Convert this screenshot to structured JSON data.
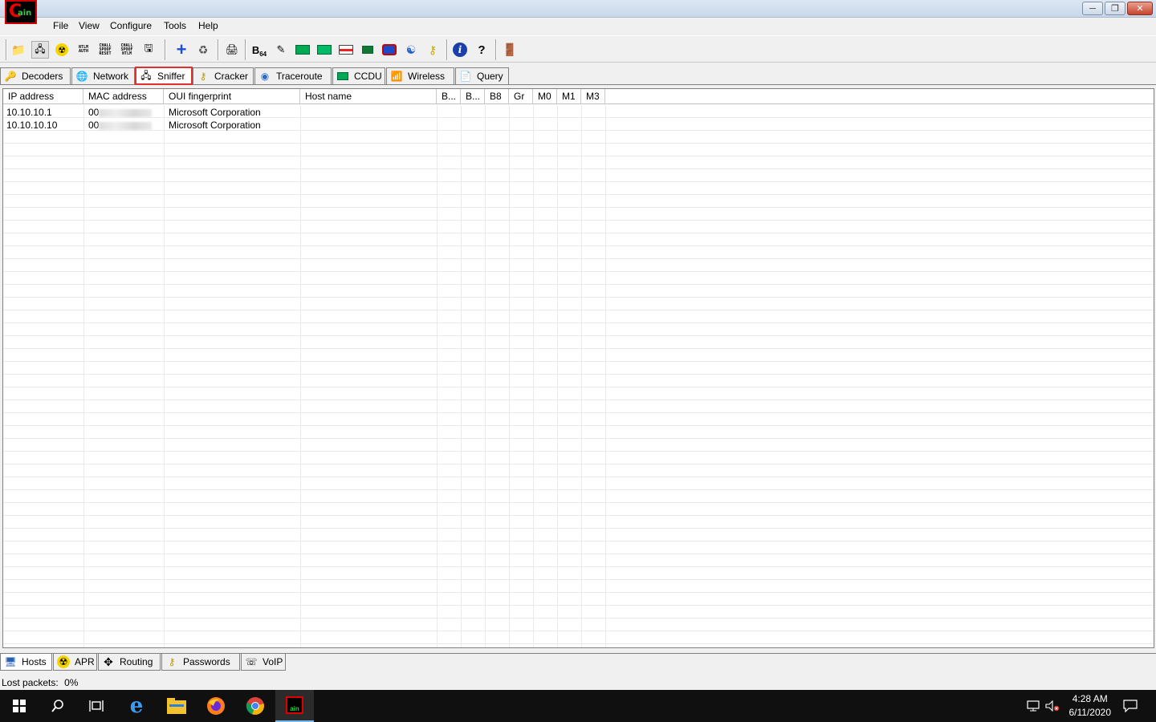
{
  "app": {
    "logo": "Cain",
    "window_buttons": [
      "minimize",
      "restore",
      "close"
    ]
  },
  "menu": [
    "File",
    "View",
    "Configure",
    "Tools",
    "Help"
  ],
  "toolbar_icons": {
    "ntlm_auth": [
      "NTLM",
      "AUTH"
    ],
    "chall_spoof_reset": [
      "CHALL",
      "SPOOF",
      "RESET"
    ],
    "chall_spoof_ntlm": [
      "CHALL",
      "SPOOF",
      "NTLM"
    ],
    "b64": "B",
    "b64_sub": "64"
  },
  "top_tabs": [
    "Decoders",
    "Network",
    "Sniffer",
    "Cracker",
    "Traceroute",
    "CCDU",
    "Wireless",
    "Query"
  ],
  "table": {
    "columns": [
      "IP address",
      "MAC address",
      "OUI fingerprint",
      "Host name",
      "B...",
      "B...",
      "B8",
      "Gr",
      "M0",
      "M1",
      "M3"
    ],
    "rows": [
      {
        "ip": "10.10.10.1",
        "mac_prefix": "00",
        "oui": "Microsoft Corporation"
      },
      {
        "ip": "10.10.10.10",
        "mac_prefix": "00",
        "oui": "Microsoft Corporation"
      }
    ]
  },
  "bottom_tabs": [
    "Hosts",
    "APR",
    "Routing",
    "Passwords",
    "VoIP"
  ],
  "status": {
    "lost_packets_label": "Lost packets:",
    "lost_packets_value": "0%"
  },
  "taskbar": {
    "time": "4:28 AM",
    "date": "6/11/2020"
  },
  "colors": {
    "active_tab_outline": "#e03030",
    "taskbar_bg": "#101010",
    "logo_red": "#e00000"
  }
}
